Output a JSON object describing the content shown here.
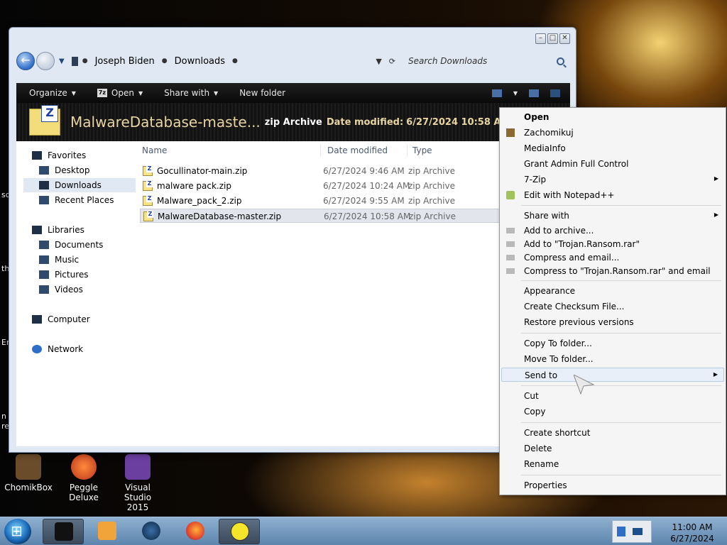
{
  "desktop": {
    "icons": [
      {
        "label": "ChomikBox"
      },
      {
        "label": "Peggle Deluxe"
      },
      {
        "label": "Visual Studio 2015"
      }
    ],
    "edge_fragments": [
      "sc",
      "th",
      "Er",
      "n\nre"
    ]
  },
  "window": {
    "controls": {
      "minimize": "–",
      "maximize": "□",
      "close": "✕"
    },
    "address": {
      "crumbs": [
        "Joseph Biden",
        "Downloads"
      ],
      "search_placeholder": "Search Downloads"
    },
    "command_bar": {
      "organize": "Organize",
      "open": "Open",
      "share_with": "Share with",
      "new_folder": "New folder"
    },
    "details": {
      "name": "MalwareDatabase-maste...",
      "type": "zip Archive",
      "modified_label": "Date modified:",
      "modified_value": "6/27/2024 10:58 AM"
    },
    "nav": {
      "favorites": "Favorites",
      "desktop": "Desktop",
      "downloads": "Downloads",
      "recent": "Recent Places",
      "libraries": "Libraries",
      "documents": "Documents",
      "music": "Music",
      "pictures": "Pictures",
      "videos": "Videos",
      "computer": "Computer",
      "network": "Network"
    },
    "columns": {
      "name": "Name",
      "date": "Date modified",
      "type": "Type"
    },
    "files": [
      {
        "name": "Gocullinator-main.zip",
        "date": "6/27/2024 9:46 AM",
        "type": "zip Archive"
      },
      {
        "name": "malware pack.zip",
        "date": "6/27/2024 10:24 AM",
        "type": "zip Archive"
      },
      {
        "name": "Malware_pack_2.zip",
        "date": "6/27/2024 9:55 AM",
        "type": "zip Archive"
      },
      {
        "name": "MalwareDatabase-master.zip",
        "date": "6/27/2024 10:58 AM",
        "type": "zip Archive"
      }
    ]
  },
  "context_menu": {
    "open": "Open",
    "zachomikuj": "Zachomikuj",
    "mediainfo": "MediaInfo",
    "grant_admin": "Grant Admin Full Control",
    "seven_zip": "7-Zip",
    "notepadpp": "Edit with Notepad++",
    "share_with": "Share with",
    "add_archive": "Add to archive...",
    "add_trojan": "Add to \"Trojan.Ransom.rar\"",
    "compress_email": "Compress and email...",
    "compress_trojan_email": "Compress to \"Trojan.Ransom.rar\" and email",
    "appearance": "Appearance",
    "checksum": "Create Checksum File...",
    "restore": "Restore previous versions",
    "copy_to": "Copy To folder...",
    "move_to": "Move To folder...",
    "send_to": "Send to",
    "cut": "Cut",
    "copy": "Copy",
    "shortcut": "Create shortcut",
    "delete": "Delete",
    "rename": "Rename",
    "properties": "Properties"
  },
  "taskbar": {
    "time": "11:00 AM",
    "date": "6/27/2024"
  },
  "colors": {
    "accent": "#2f6ec8",
    "menu_hover": "#e8eff8",
    "details_text": "#e7d4a0"
  }
}
